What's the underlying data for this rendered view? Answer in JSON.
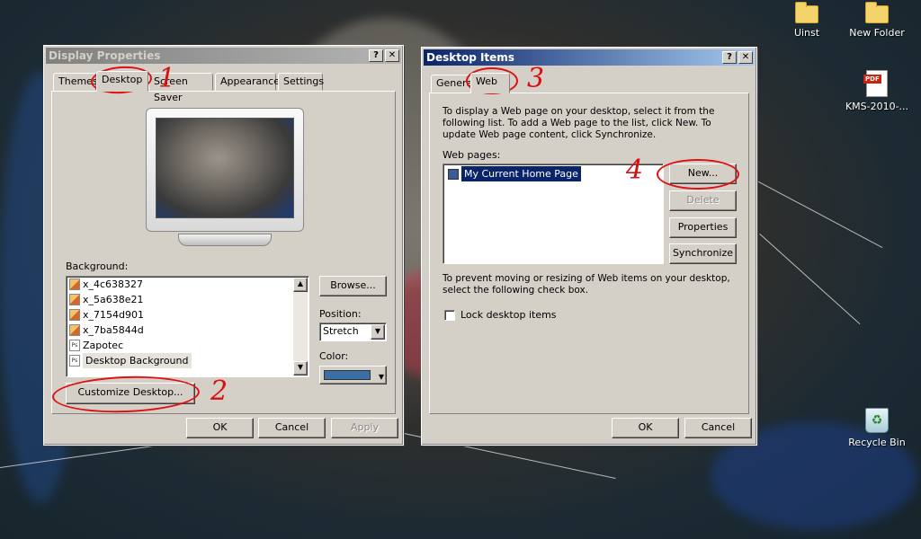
{
  "desktop": {
    "icons": [
      {
        "label": "Uinst",
        "icon": "folder-icon"
      },
      {
        "label": "New Folder",
        "icon": "folder-icon"
      },
      {
        "label": "KMS-2010-...",
        "icon": "pdf-icon",
        "badge": "PDF"
      },
      {
        "label": "Recycle Bin",
        "icon": "recycle-bin-icon"
      }
    ]
  },
  "display_properties": {
    "title": "Display Properties",
    "title_buttons": {
      "help": "?",
      "close": "✕"
    },
    "tabs": [
      "Themes",
      "Desktop",
      "Screen Saver",
      "Appearance",
      "Settings"
    ],
    "active_tab": "Desktop",
    "background_label": "Background:",
    "backgrounds": [
      "x_4c638327",
      "x_5a638e21",
      "x_7154d901",
      "x_7ba5844d",
      "Zapotec",
      "Desktop Background"
    ],
    "selected_background": "Desktop Background",
    "browse": "Browse...",
    "position_label": "Position:",
    "position_value": "Stretch",
    "color_label": "Color:",
    "color_value": "#3a6ea5",
    "customize": "Customize Desktop...",
    "ok": "OK",
    "cancel": "Cancel",
    "apply": "Apply"
  },
  "desktop_items": {
    "title": "Desktop Items",
    "title_buttons": {
      "help": "?",
      "close": "✕"
    },
    "tabs": [
      "General",
      "Web"
    ],
    "active_tab": "Web",
    "description": "To display a Web page on your desktop, select it from the following list. To add a Web page to the list, click New.  To update Web page content, click Synchronize.",
    "web_pages_label": "Web pages:",
    "web_pages": [
      "My Current Home Page"
    ],
    "new": "New...",
    "delete": "Delete",
    "properties": "Properties",
    "synchronize": "Synchronize",
    "lock_description": "To prevent moving or resizing of Web items on your desktop, select the following check box.",
    "lock_label": "Lock desktop items",
    "lock_checked": false,
    "ok": "OK",
    "cancel": "Cancel"
  },
  "annotations": {
    "step1": "1",
    "step2": "2",
    "step3": "3",
    "step4": "4",
    "color": "#e01010"
  }
}
